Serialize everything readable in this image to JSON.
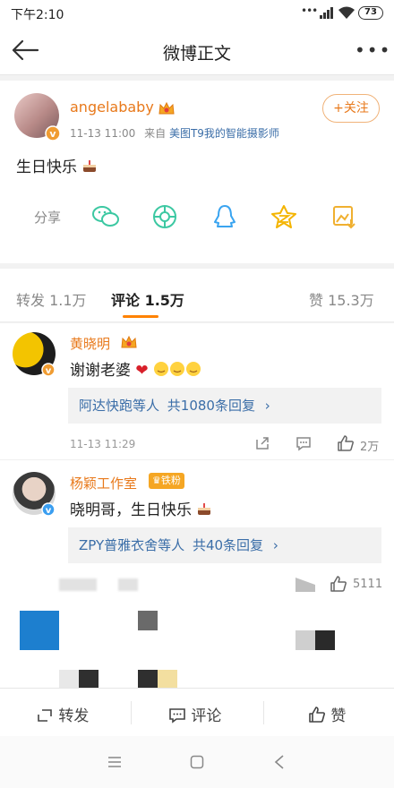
{
  "status": {
    "time": "下午2:10",
    "battery": "73"
  },
  "nav": {
    "title": "微博正文"
  },
  "post": {
    "author": "angelababy",
    "time": "11-13 11:00",
    "from_label": "来自",
    "source": "美图T9我的智能摄影师",
    "follow_label": "关注",
    "content": "生日快乐",
    "share_label": "分享"
  },
  "tabs": {
    "repost": "转发 1.1万",
    "comments": "评论 1.5万",
    "likes": "赞 15.3万"
  },
  "comments": [
    {
      "name": "黄晓明",
      "text": "谢谢老婆",
      "reply_summary": "阿达快跑等人",
      "reply_count": "共1080条回复",
      "time": "11-13 11:29",
      "likes": "2万"
    },
    {
      "name": "杨颖工作室",
      "badge": "铁粉",
      "text": "晓明哥，生日快乐",
      "reply_summary": "ZPY普雅衣舍等人",
      "reply_count": "共40条回复",
      "likes": "5111"
    }
  ],
  "bottom": {
    "repost": "转发",
    "comment": "评论",
    "like": "赞"
  },
  "colors": {
    "accent": "#ff8200",
    "name": "#e8791b",
    "link": "#3b6ea8"
  }
}
